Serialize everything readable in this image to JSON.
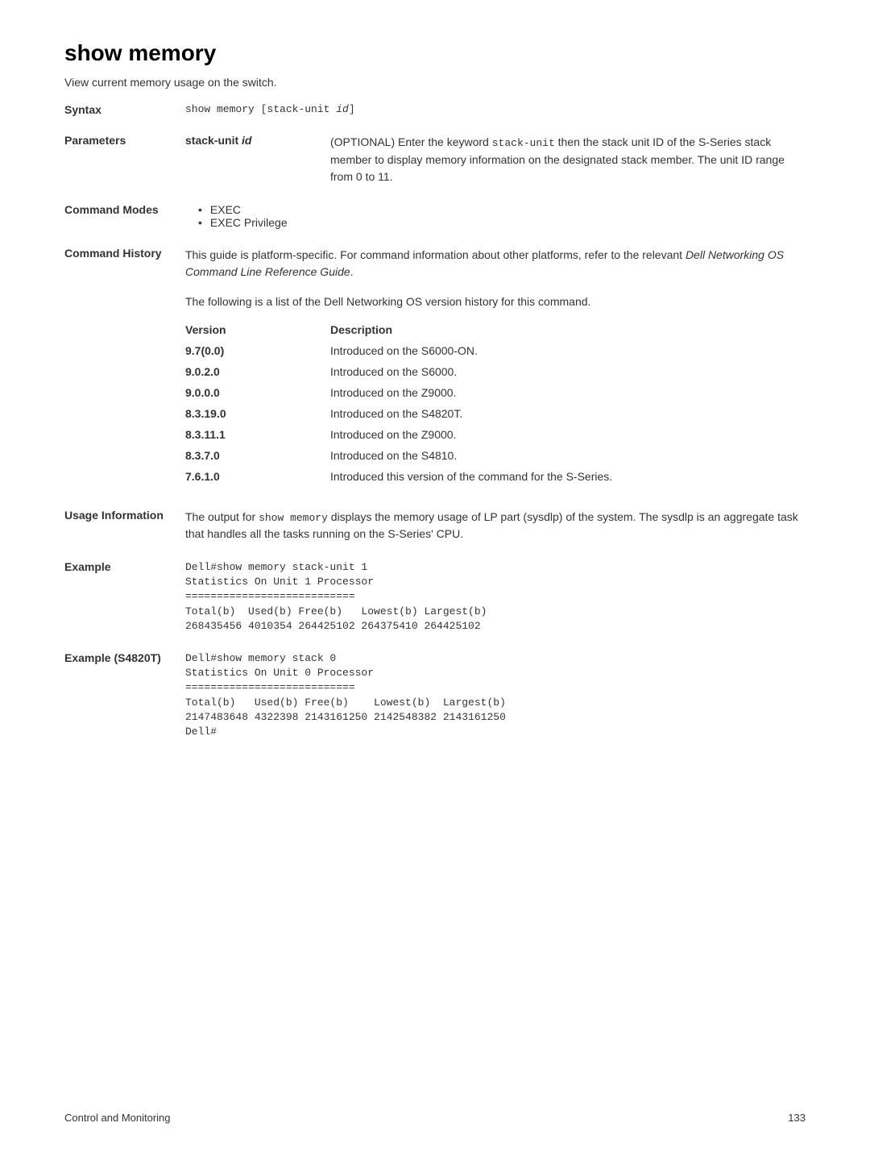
{
  "title": "show memory",
  "subtitle": "View current memory usage on the switch.",
  "syntax": {
    "label": "Syntax",
    "command": "show memory [stack-unit ",
    "command_param": "id",
    "command_end": "]"
  },
  "parameters": {
    "label": "Parameters",
    "name_prefix": "stack-unit ",
    "name_param": "id",
    "desc_prefix": "(OPTIONAL) Enter the keyword ",
    "desc_code": "stack-unit",
    "desc_suffix": " then the stack unit ID of the S-Series stack member to display memory information on the designated stack member. The unit ID range from 0 to 11."
  },
  "command_modes": {
    "label": "Command Modes",
    "items": [
      "EXEC",
      "EXEC Privilege"
    ]
  },
  "command_history": {
    "label": "Command History",
    "para1_prefix": "This guide is platform-specific. For command information about other platforms, refer to the relevant ",
    "para1_italic": "Dell Networking OS Command Line Reference Guide",
    "para1_suffix": ".",
    "para2": "The following is a list of the Dell Networking OS version history for this command.",
    "headers": {
      "version": "Version",
      "description": "Description"
    },
    "rows": [
      {
        "version": "9.7(0.0)",
        "description": "Introduced on the S6000-ON."
      },
      {
        "version": "9.0.2.0",
        "description": "Introduced on the S6000."
      },
      {
        "version": "9.0.0.0",
        "description": "Introduced on the Z9000."
      },
      {
        "version": "8.3.19.0",
        "description": "Introduced on the S4820T."
      },
      {
        "version": "8.3.11.1",
        "description": "Introduced on the Z9000."
      },
      {
        "version": "8.3.7.0",
        "description": "Introduced on the S4810."
      },
      {
        "version": "7.6.1.0",
        "description": "Introduced this version of the command for the S-Series."
      }
    ]
  },
  "usage_info": {
    "label": "Usage Information",
    "prefix": "The output for ",
    "code": "show memory",
    "suffix": " displays the memory usage of LP part (sysdlp) of the system. The sysdlp is an aggregate task that handles all the tasks running on the S-Series' CPU."
  },
  "example1": {
    "label": "Example",
    "content": "Dell#show memory stack-unit 1\nStatistics On Unit 1 Processor\n===========================\nTotal(b)  Used(b) Free(b)   Lowest(b) Largest(b)\n268435456 4010354 264425102 264375410 264425102"
  },
  "example2": {
    "label": "Example (S4820T)",
    "content": "Dell#show memory stack 0\nStatistics On Unit 0 Processor\n===========================\nTotal(b)   Used(b) Free(b)    Lowest(b)  Largest(b)\n2147483648 4322398 2143161250 2142548382 2143161250\nDell#"
  },
  "footer": {
    "left": "Control and Monitoring",
    "right": "133"
  }
}
